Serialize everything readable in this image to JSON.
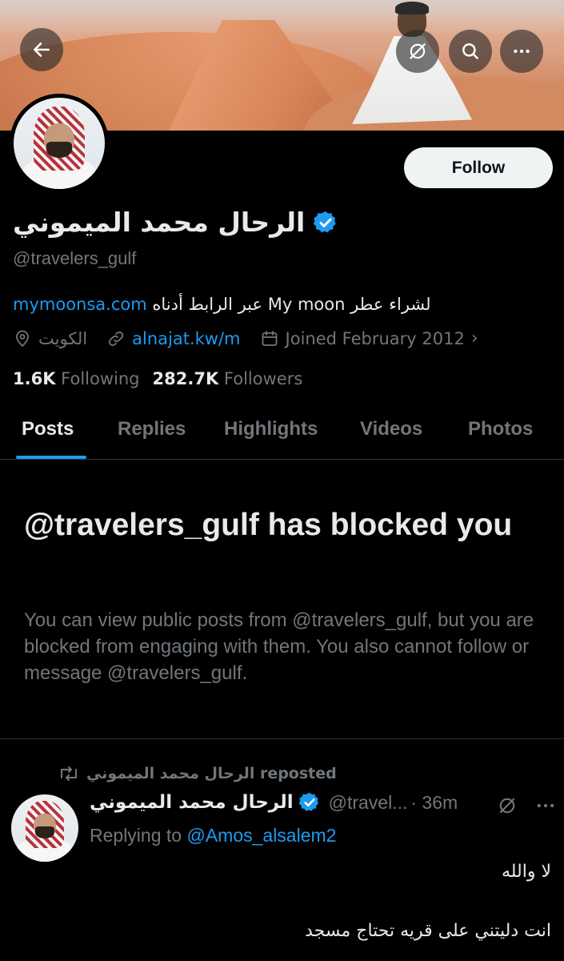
{
  "profile": {
    "display_name": "الرحال محمد الميموني",
    "handle": "@travelers_gulf",
    "bio_link": "mymoonsa.com",
    "bio_text": " عبر الرابط أدناه My moon لشراء عطر",
    "location": "الكويت",
    "website": "alnajat.kw/m",
    "joined": "Joined February 2012",
    "following_count": "1.6K",
    "following_label": "Following",
    "followers_count": "282.7K",
    "followers_label": "Followers",
    "follow_label": "Follow"
  },
  "tabs": [
    {
      "label": "Posts",
      "active": true
    },
    {
      "label": "Replies"
    },
    {
      "label": "Highlights"
    },
    {
      "label": "Videos"
    },
    {
      "label": "Photos"
    }
  ],
  "blocked": {
    "title": "@travelers_gulf has blocked you",
    "body": "You can view public posts from @travelers_gulf, but you are blocked from engaging with them. You also cannot follow or message @travelers_gulf."
  },
  "tweet": {
    "repost_label": "الرحال محمد الميموني reposted",
    "author_name": "الرحال محمد الميموني",
    "author_handle": "@travel...",
    "time": "· 36m",
    "replying_prefix": "Replying to",
    "replying_to": "@Amos_alsalem2",
    "line1": "لا والله",
    "line2": "انت دليتني على قريه تحتاج مسجد"
  },
  "icons": {
    "back": "arrow-left-icon",
    "grok": "grok-icon",
    "search": "search-icon",
    "more": "more-icon",
    "verified": "verified-badge-icon",
    "location": "location-pin-icon",
    "link": "link-icon",
    "calendar": "calendar-icon",
    "repost": "repost-icon"
  },
  "colors": {
    "accent": "#1d9bf0",
    "muted": "#71767b",
    "text": "#e7e9ea",
    "background": "#000000"
  }
}
